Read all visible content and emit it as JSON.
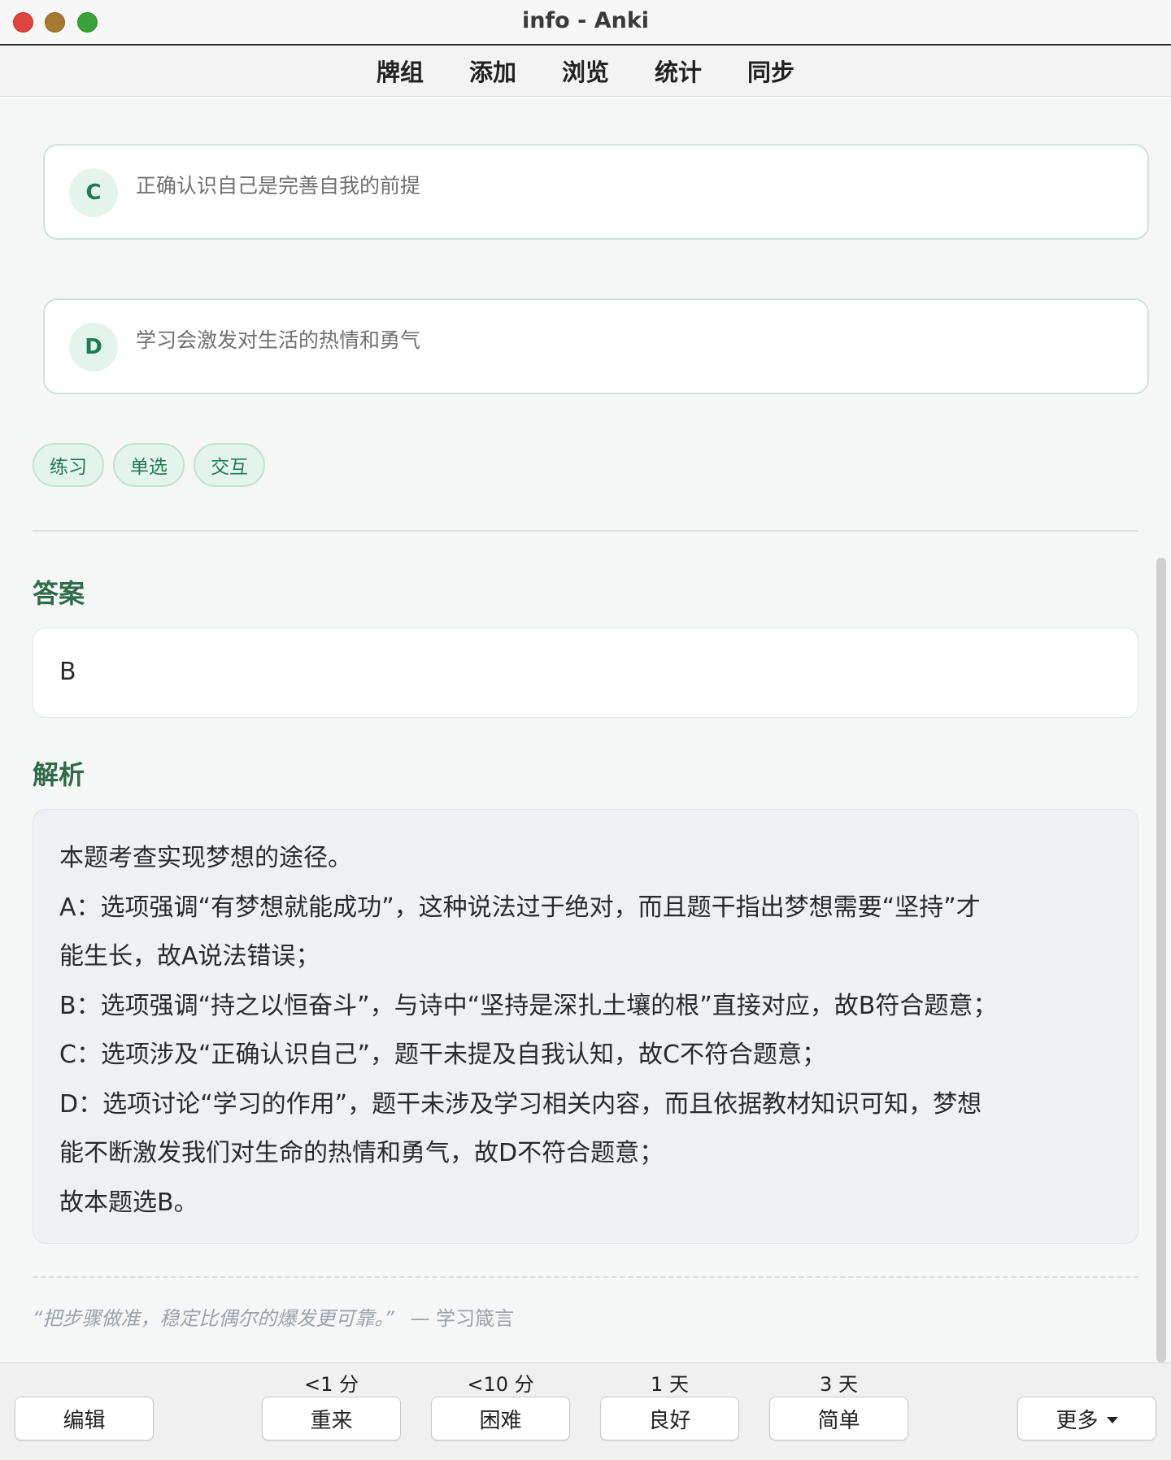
{
  "window": {
    "title": "info - Anki"
  },
  "toolbar": {
    "items": [
      "牌组",
      "添加",
      "浏览",
      "统计",
      "同步"
    ]
  },
  "options": [
    {
      "letter": "C",
      "text": "正确认识自己是完善自我的前提"
    },
    {
      "letter": "D",
      "text": "学习会激发对生活的热情和勇气"
    }
  ],
  "tags": [
    "练习",
    "单选",
    "交互"
  ],
  "answer": {
    "title": "答案",
    "value": "B"
  },
  "analysis": {
    "title": "解析",
    "lines": [
      "本题考查实现梦想的途径。",
      "A：选项强调“有梦想就能成功”，这种说法过于绝对，而且题干指出梦想需要“坚持”才",
      "能生长，故A说法错误；",
      "B：选项强调“持之以恒奋斗”，与诗中“坚持是深扎土壤的根”直接对应，故B符合题意；",
      "C：选项涉及“正确认识自己”，题干未提及自我认知，故C不符合题意；",
      "D：选项讨论“学习的作用”，题干未涉及学习相关内容，而且依据教材知识可知，梦想",
      "能不断激发我们对生命的热情和勇气，故D不符合题意；",
      "故本题选B。"
    ]
  },
  "quote": {
    "text": "“把步骤做准，稳定比偶尔的爆发更可靠。”",
    "source": "— 学习箴言"
  },
  "bottom": {
    "edit_label": "编辑",
    "more_label": "更多",
    "answers": [
      {
        "interval": "<1 分",
        "label": "重来"
      },
      {
        "interval": "<10 分",
        "label": "困难"
      },
      {
        "interval": "1 天",
        "label": "良好"
      },
      {
        "interval": "3 天",
        "label": "简单"
      }
    ]
  }
}
